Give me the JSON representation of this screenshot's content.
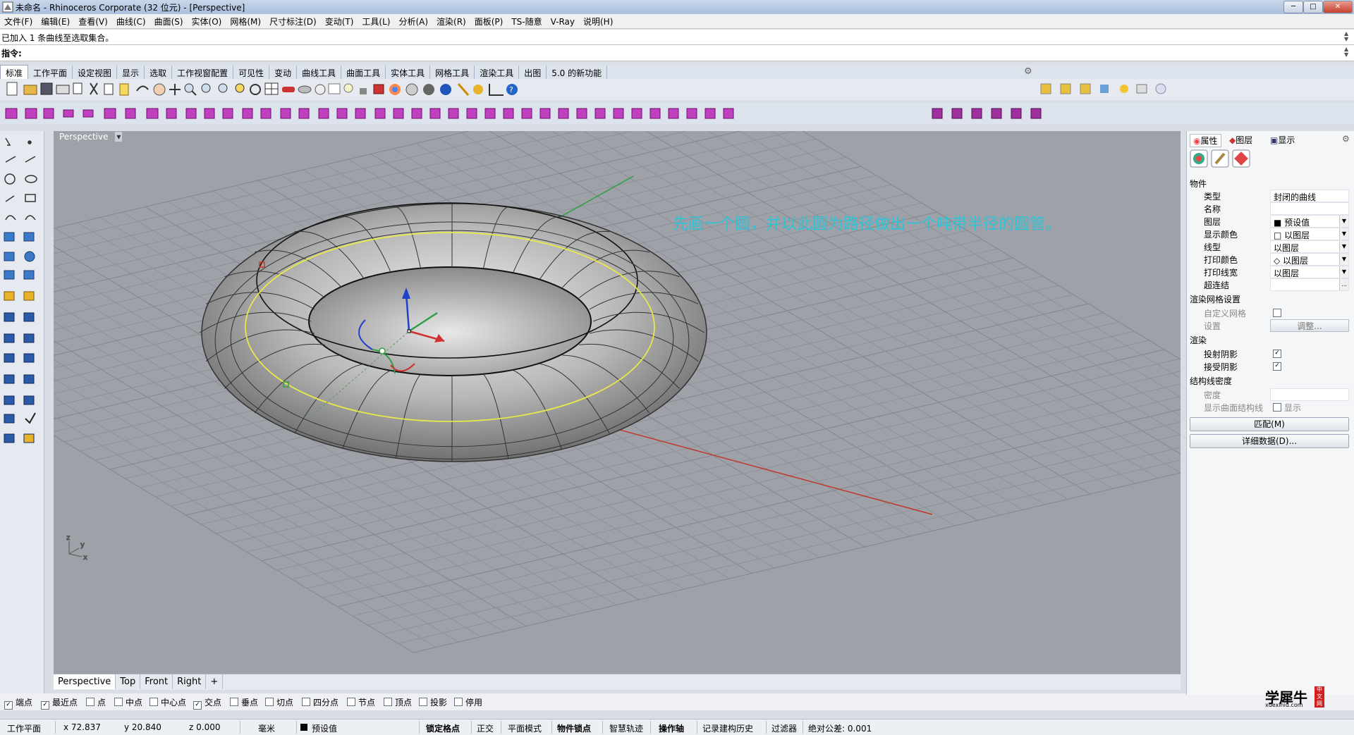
{
  "window": {
    "title": "未命名 - Rhinoceros Corporate (32 位元) - [Perspective]",
    "min_label": "─",
    "max_label": "□",
    "close_label": "✕"
  },
  "menu": [
    "文件(F)",
    "编辑(E)",
    "查看(V)",
    "曲线(C)",
    "曲面(S)",
    "实体(O)",
    "网格(M)",
    "尺寸标注(D)",
    "变动(T)",
    "工具(L)",
    "分析(A)",
    "渲染(R)",
    "面板(P)",
    "TS-随意",
    "V-Ray",
    "说明(H)"
  ],
  "command": {
    "history": "已加入 1 条曲线至选取集合。",
    "prompt": "指令:"
  },
  "toolbar_tabs": [
    "标准",
    "工作平面",
    "设定视图",
    "显示",
    "选取",
    "工作视窗配置",
    "可见性",
    "变动",
    "曲线工具",
    "曲面工具",
    "实体工具",
    "网格工具",
    "渲染工具",
    "出图",
    "5.0 的新功能"
  ],
  "viewport": {
    "name": "Perspective",
    "dropdown_icon": "▾",
    "annotation": "先画一个圆，并以此圆为路径做出一个吨带半径的圆管。",
    "annotation_color": "#2ec4d6",
    "axis_labels": {
      "z": "z",
      "y": "y",
      "x": "x"
    }
  },
  "view_tabs": [
    "Perspective",
    "Top",
    "Front",
    "Right"
  ],
  "add_view_icon": "+",
  "osnap": [
    {
      "label": "端点",
      "checked": true
    },
    {
      "label": "最近点",
      "checked": true
    },
    {
      "label": "点",
      "checked": false
    },
    {
      "label": "中点",
      "checked": false
    },
    {
      "label": "中心点",
      "checked": false
    },
    {
      "label": "交点",
      "checked": true
    },
    {
      "label": "垂点",
      "checked": false
    },
    {
      "label": "切点",
      "checked": false
    },
    {
      "label": "四分点",
      "checked": false
    },
    {
      "label": "节点",
      "checked": false
    },
    {
      "label": "顶点",
      "checked": false
    },
    {
      "label": "投影",
      "checked": false
    },
    {
      "label": "停用",
      "checked": false
    }
  ],
  "status": {
    "cplane": "工作平面",
    "x": "x 72.837",
    "y": "y 20.840",
    "z": "z 0.000",
    "units": "毫米",
    "layer": "预设值",
    "grid_snap": "锁定格点",
    "ortho": "正交",
    "planar": "平面模式",
    "osnap": "物件锁点",
    "smarttrack": "智慧轨迹",
    "gumball": "操作轴",
    "history": "记录建构历史",
    "filter": "过滤器",
    "tolerance": "绝对公差: 0.001"
  },
  "panel": {
    "tabs": [
      "属性",
      "图层",
      "显示"
    ],
    "section_object": "物件",
    "props": [
      {
        "k": "类型",
        "v": "封闭的曲线",
        "dd": false
      },
      {
        "k": "名称",
        "v": "",
        "dd": false
      },
      {
        "k": "图层",
        "v": "■ 预设值",
        "dd": true
      },
      {
        "k": "显示颜色",
        "v": "□ 以图层",
        "dd": true
      },
      {
        "k": "线型",
        "v": "以图层",
        "dd": true
      },
      {
        "k": "打印颜色",
        "v": "◇ 以图层",
        "dd": true
      },
      {
        "k": "打印线宽",
        "v": "以图层",
        "dd": true
      },
      {
        "k": "超连结",
        "v": "",
        "dd": false
      }
    ],
    "section_mesh": "渲染网格设置",
    "mesh_custom": "自定义网格",
    "mesh_settings": "设置",
    "mesh_adjust": "调整...",
    "section_render": "渲染",
    "cast_shadows": "投射阴影",
    "receive_shadows": "接受阴影",
    "section_isocurve": "结构线密度",
    "density": "密度",
    "show_isocurves": "显示曲面结构线",
    "show_label": "显示",
    "match_button": "匹配(M)",
    "details_button": "详细数据(D)...",
    "ellipsis": "..."
  },
  "logo": {
    "text": "学犀牛",
    "sub": "xuexiniu.com",
    "badge": "中文网"
  },
  "colors": {
    "viewport_bg": "#9ea1a8",
    "x_axis": "#c0392b",
    "y_axis": "#2f9e44",
    "curve": "#e8e84a"
  }
}
